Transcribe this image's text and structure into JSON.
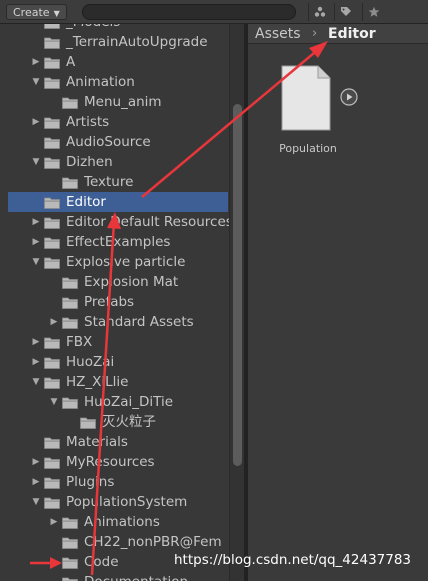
{
  "toolbar": {
    "create_label": "Create",
    "icons": [
      "scene-filter-icon",
      "label-filter-icon",
      "favorite-star-icon"
    ]
  },
  "tree": {
    "rows": [
      {
        "label": "_Models",
        "depth": 1,
        "expand": "none"
      },
      {
        "label": "_TerrainAutoUpgrade",
        "depth": 1,
        "expand": "none"
      },
      {
        "label": "A",
        "depth": 1,
        "expand": "collapsed"
      },
      {
        "label": "Animation",
        "depth": 1,
        "expand": "expanded"
      },
      {
        "label": "Menu_anim",
        "depth": 2,
        "expand": "none"
      },
      {
        "label": "Artists",
        "depth": 1,
        "expand": "collapsed"
      },
      {
        "label": "AudioSource",
        "depth": 1,
        "expand": "none"
      },
      {
        "label": "Dizhen",
        "depth": 1,
        "expand": "expanded"
      },
      {
        "label": "Texture",
        "depth": 2,
        "expand": "none"
      },
      {
        "label": "Editor",
        "depth": 1,
        "expand": "none",
        "selected": true
      },
      {
        "label": "Editor Default Resources",
        "depth": 1,
        "expand": "collapsed"
      },
      {
        "label": "EffectExamples",
        "depth": 1,
        "expand": "collapsed"
      },
      {
        "label": "Explosive particle",
        "depth": 1,
        "expand": "expanded"
      },
      {
        "label": "Explosion Mat",
        "depth": 2,
        "expand": "none"
      },
      {
        "label": "Prefabs",
        "depth": 2,
        "expand": "none"
      },
      {
        "label": "Standard Assets",
        "depth": 2,
        "expand": "collapsed"
      },
      {
        "label": "FBX",
        "depth": 1,
        "expand": "collapsed"
      },
      {
        "label": "HuoZai",
        "depth": 1,
        "expand": "collapsed"
      },
      {
        "label": "HZ_XiLlie",
        "depth": 1,
        "expand": "expanded"
      },
      {
        "label": "HuoZai_DiTie",
        "depth": 2,
        "expand": "expanded"
      },
      {
        "label": "灭火粒子",
        "depth": 3,
        "expand": "none"
      },
      {
        "label": "Materials",
        "depth": 1,
        "expand": "none"
      },
      {
        "label": "MyResources",
        "depth": 1,
        "expand": "collapsed"
      },
      {
        "label": "Plugins",
        "depth": 1,
        "expand": "collapsed"
      },
      {
        "label": "PopulationSystem",
        "depth": 1,
        "expand": "expanded"
      },
      {
        "label": "Animations",
        "depth": 2,
        "expand": "collapsed"
      },
      {
        "label": "CH22_nonPBR@Fem",
        "depth": 2,
        "expand": "none"
      },
      {
        "label": "Code",
        "depth": 2,
        "expand": "none"
      },
      {
        "label": "Documentation",
        "depth": 2,
        "expand": "none"
      }
    ]
  },
  "breadcrumb": {
    "root": "Assets",
    "separator": "›",
    "current": "Editor"
  },
  "asset_grid": {
    "items": [
      {
        "label": "Population",
        "icon": "script-file-icon"
      }
    ]
  },
  "watermark": "https://blog.csdn.net/qq_42437783",
  "colors": {
    "selection": "#3e5f96",
    "annotation_arrow": "#e8363a",
    "folder": "#b9b9b9"
  }
}
